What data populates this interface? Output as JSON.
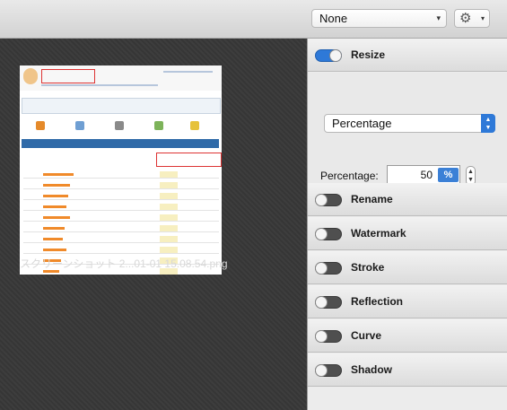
{
  "toolbar": {
    "preset_value": "None",
    "preset_chevron": "▾",
    "gear_glyph": "⚙",
    "gear_chevron": "▾"
  },
  "canvas": {
    "filename": "スクリーンショット 2...01-01 15.08.54.png"
  },
  "panel": {
    "resize": {
      "label": "Resize",
      "enabled": true,
      "mode_value": "Percentage",
      "percentage_label": "Percentage:",
      "percentage_value": "50",
      "percentage_unit": "%"
    },
    "effects": [
      {
        "label": "Rename",
        "enabled": false
      },
      {
        "label": "Watermark",
        "enabled": false
      },
      {
        "label": "Stroke",
        "enabled": false
      },
      {
        "label": "Reflection",
        "enabled": false
      },
      {
        "label": "Curve",
        "enabled": false
      },
      {
        "label": "Shadow",
        "enabled": false
      }
    ]
  },
  "colors": {
    "accent": "#2e79d8",
    "toggle_off": "#4f4f4f",
    "canvas_bg": "#3b3b3b",
    "panel_bg": "#ececec"
  }
}
